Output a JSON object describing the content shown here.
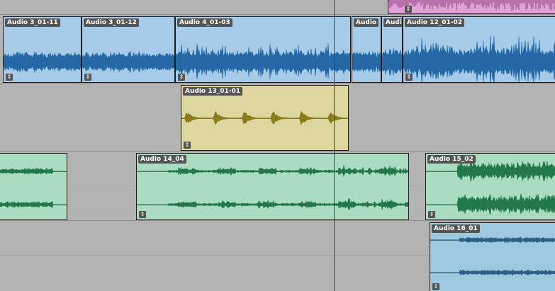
{
  "colors": {
    "background": "#b3b3b3",
    "blue_clip_fill": "#a5cbe9",
    "blue_wave": "#2469a6",
    "yellow_clip_fill": "#ddd79f",
    "yellow_wave": "#8a7c1c",
    "green_clip_fill": "#a9dcc0",
    "green_wave": "#23784a",
    "lightblue_clip_fill": "#9cc8e0",
    "lightblue_wave": "#2d5f82",
    "pink_clip_fill": "#e0a2d4",
    "pink_wave": "#7a2a6e",
    "label_bg": "#555555",
    "label_text": "#ffffff"
  },
  "handle_glyph": "⇕",
  "tracks": [
    {
      "id": "track-1",
      "clips": [
        {
          "name": "Audio 3_01-11",
          "color": "blue"
        },
        {
          "name": "Audio 3_01-12",
          "color": "blue"
        },
        {
          "name": "Audio 4_01-03",
          "color": "blue"
        },
        {
          "name": "Audio",
          "color": "blue"
        },
        {
          "name": "Audio",
          "color": "blue"
        },
        {
          "name": "Audio 12_01-02",
          "color": "blue"
        }
      ]
    },
    {
      "id": "track-2",
      "clips": [
        {
          "name": "Audio 13_01-01",
          "color": "yellow"
        }
      ]
    },
    {
      "id": "track-3",
      "clips": [
        {
          "name": "",
          "color": "green"
        },
        {
          "name": "Audio 14_04",
          "color": "green"
        },
        {
          "name": "Audio 15_02",
          "color": "green"
        }
      ]
    },
    {
      "id": "track-4",
      "clips": [
        {
          "name": "Audio 16_01",
          "color": "lightblue"
        }
      ]
    }
  ]
}
